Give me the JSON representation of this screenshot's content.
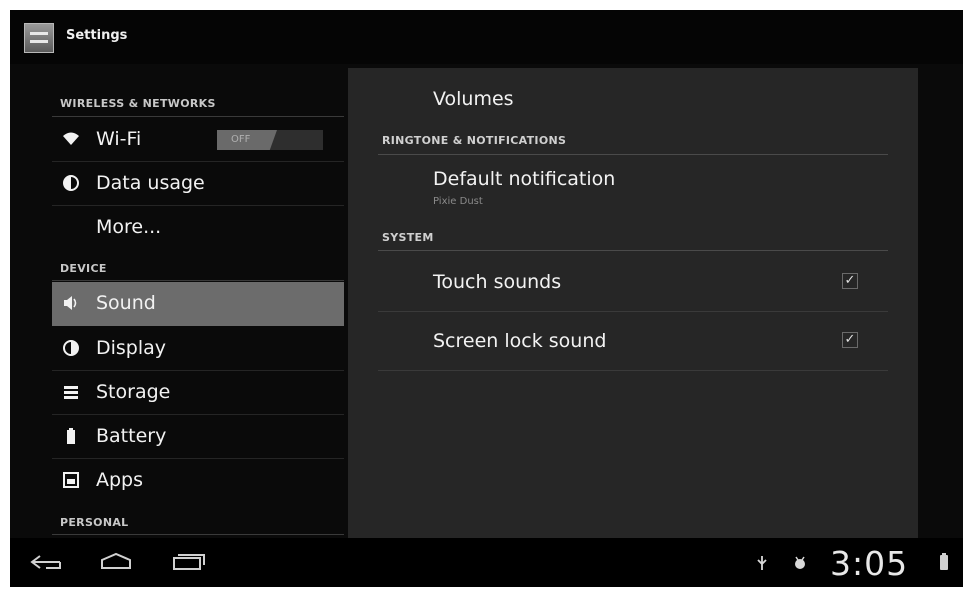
{
  "action_bar": {
    "title": "Settings",
    "icon": "settings-icon"
  },
  "left_pane": {
    "sections": [
      {
        "header": "WIRELESS & NETWORKS",
        "items": [
          {
            "label": "Wi-Fi",
            "icon": "wifi-icon",
            "toggle": "OFF"
          },
          {
            "label": "Data usage",
            "icon": "data-usage-icon"
          },
          {
            "label": "More...",
            "icon": ""
          }
        ]
      },
      {
        "header": "DEVICE",
        "items": [
          {
            "label": "Sound",
            "icon": "sound-icon",
            "selected": true
          },
          {
            "label": "Display",
            "icon": "display-icon"
          },
          {
            "label": "Storage",
            "icon": "storage-icon"
          },
          {
            "label": "Battery",
            "icon": "battery-icon"
          },
          {
            "label": "Apps",
            "icon": "apps-icon"
          }
        ]
      },
      {
        "header": "PERSONAL",
        "items": []
      }
    ]
  },
  "right_pane": {
    "volumes": "Volumes",
    "ringtone_header": "RINGTONE & NOTIFICATIONS",
    "default_notification": {
      "title": "Default notification",
      "summary": "Pixie Dust"
    },
    "system_header": "SYSTEM",
    "touch_sounds": {
      "title": "Touch sounds",
      "checked": true
    },
    "screen_lock_sound": {
      "title": "Screen lock sound",
      "checked": true
    }
  },
  "system_bar": {
    "time": "3:05",
    "status_icons": [
      "usb-icon",
      "usb-debugging-icon",
      "battery-status-icon"
    ],
    "nav": [
      "back-icon",
      "home-icon",
      "recent-apps-icon"
    ]
  },
  "colors": {
    "background": "#0a0a0a",
    "detail_pane": "#262626",
    "selected_item": "#6c6c6c",
    "text": "#f2f2f2"
  }
}
